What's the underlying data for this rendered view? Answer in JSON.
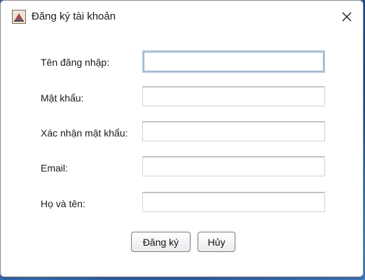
{
  "window": {
    "title": "Đăng ký tài khoản",
    "app_icon": "java-coffee-cup-icon",
    "close_icon": "close-icon"
  },
  "form": {
    "fields": [
      {
        "label": "Tên đăng nhập:",
        "value": "",
        "placeholder": ""
      },
      {
        "label": "Mật khẩu:",
        "value": "",
        "placeholder": ""
      },
      {
        "label": "Xác nhận mật khẩu:",
        "value": "",
        "placeholder": ""
      },
      {
        "label": "Email:",
        "value": "",
        "placeholder": ""
      },
      {
        "label": "Họ và tên:",
        "value": "",
        "placeholder": ""
      }
    ],
    "focused_field": "Tên đăng nhập:"
  },
  "buttons": {
    "register_label": "Đăng ký",
    "cancel_label": "Hủy"
  },
  "colors": {
    "window_bg": "#ffffff",
    "focus_border": "#8ea8c7",
    "desktop_accent": "#2a5ea8"
  }
}
